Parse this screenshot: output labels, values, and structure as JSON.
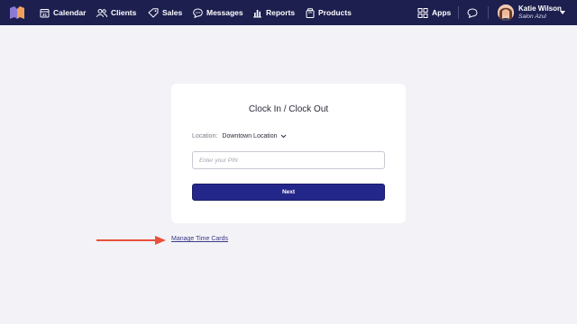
{
  "nav": {
    "items": [
      {
        "label": "Calendar",
        "icon": "calendar-icon"
      },
      {
        "label": "Clients",
        "icon": "clients-icon"
      },
      {
        "label": "Sales",
        "icon": "tag-icon"
      },
      {
        "label": "Messages",
        "icon": "message-icon"
      },
      {
        "label": "Reports",
        "icon": "reports-icon"
      },
      {
        "label": "Products",
        "icon": "products-icon"
      }
    ],
    "apps_label": "Apps",
    "user": {
      "name": "Katie Wilson",
      "business": "Salon Azul"
    }
  },
  "card": {
    "title": "Clock In / Clock Out",
    "location_label": "Location:",
    "location_value": "Downtown Location",
    "pin_placeholder": "Enter your PIN",
    "next_label": "Next"
  },
  "manage_link": "Manage Time Cards",
  "colors": {
    "nav_bg": "#1d1f4f",
    "primary_button": "#24278a",
    "annotation_arrow": "#e8513a",
    "page_bg": "#f3f2f7"
  }
}
